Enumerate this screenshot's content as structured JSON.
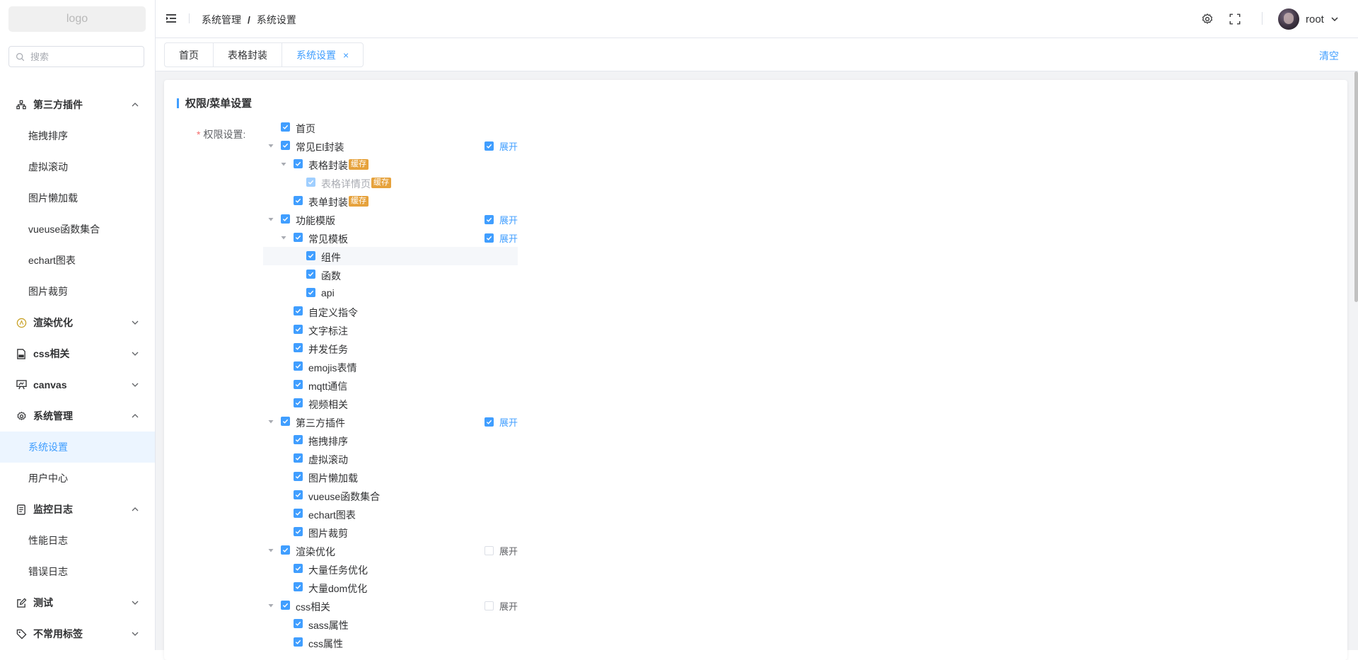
{
  "sidebar": {
    "logo": "logo",
    "search_placeholder": "搜索",
    "menu": [
      {
        "label": "第三方插件",
        "type": "group",
        "expanded": true,
        "icon": "plugin-icon"
      },
      {
        "label": "拖拽排序",
        "type": "sub"
      },
      {
        "label": "虚拟滚动",
        "type": "sub"
      },
      {
        "label": "图片懒加载",
        "type": "sub"
      },
      {
        "label": "vueuse函数集合",
        "type": "sub"
      },
      {
        "label": "echart图表",
        "type": "sub"
      },
      {
        "label": "图片裁剪",
        "type": "sub"
      },
      {
        "label": "渲染优化",
        "type": "group",
        "expanded": false,
        "icon": "render-icon"
      },
      {
        "label": "css相关",
        "type": "group",
        "expanded": false,
        "icon": "css-icon"
      },
      {
        "label": "canvas",
        "type": "group",
        "expanded": false,
        "icon": "canvas-icon"
      },
      {
        "label": "系统管理",
        "type": "group",
        "expanded": true,
        "icon": "gear-icon"
      },
      {
        "label": "系统设置",
        "type": "sub",
        "active": true
      },
      {
        "label": "用户中心",
        "type": "sub"
      },
      {
        "label": "监控日志",
        "type": "group",
        "expanded": true,
        "icon": "document-icon"
      },
      {
        "label": "性能日志",
        "type": "sub"
      },
      {
        "label": "错误日志",
        "type": "sub"
      },
      {
        "label": "测试",
        "type": "group",
        "expanded": false,
        "icon": "edit-icon"
      },
      {
        "label": "不常用标签",
        "type": "group",
        "expanded": false,
        "icon": "tag-icon"
      }
    ]
  },
  "header": {
    "breadcrumb": [
      "系统管理",
      "系统设置"
    ],
    "breadcrumb_sep": "/",
    "username": "root"
  },
  "tabs": {
    "items": [
      {
        "label": "首页",
        "active": false
      },
      {
        "label": "表格封装",
        "active": false
      },
      {
        "label": "系统设置",
        "active": true,
        "closable": true
      }
    ],
    "close_glyph": "×",
    "clear_label": "清空"
  },
  "card": {
    "title": "权限/菜单设置",
    "required_mark": "*",
    "field_label": "权限设置:"
  },
  "tree": [
    {
      "label": "首页",
      "level": 0,
      "checked": true
    },
    {
      "label": "常见El封装",
      "level": 0,
      "checked": true,
      "caret": true,
      "expand": {
        "label": "展开",
        "checked": true
      }
    },
    {
      "label": "表格封装",
      "level": 1,
      "checked": true,
      "caret": true,
      "tag": "缓存"
    },
    {
      "label": "表格详情页",
      "level": 2,
      "checked": true,
      "dim": true,
      "tag": "缓存"
    },
    {
      "label": "表单封装",
      "level": 1,
      "checked": true,
      "tag": "缓存"
    },
    {
      "label": "功能模版",
      "level": 0,
      "checked": true,
      "caret": true,
      "expand": {
        "label": "展开",
        "checked": true
      }
    },
    {
      "label": "常见模板",
      "level": 1,
      "checked": true,
      "caret": true,
      "expand": {
        "label": "展开",
        "checked": true
      }
    },
    {
      "label": "组件",
      "level": 2,
      "checked": true,
      "highlight": true
    },
    {
      "label": "函数",
      "level": 2,
      "checked": true
    },
    {
      "label": "api",
      "level": 2,
      "checked": true
    },
    {
      "label": "自定义指令",
      "level": 1,
      "checked": true
    },
    {
      "label": "文字标注",
      "level": 1,
      "checked": true
    },
    {
      "label": "并发任务",
      "level": 1,
      "checked": true
    },
    {
      "label": "emojis表情",
      "level": 1,
      "checked": true
    },
    {
      "label": "mqtt通信",
      "level": 1,
      "checked": true
    },
    {
      "label": "视频相关",
      "level": 1,
      "checked": true
    },
    {
      "label": "第三方插件",
      "level": 0,
      "checked": true,
      "caret": true,
      "expand": {
        "label": "展开",
        "checked": true
      }
    },
    {
      "label": "拖拽排序",
      "level": 1,
      "checked": true
    },
    {
      "label": "虚拟滚动",
      "level": 1,
      "checked": true
    },
    {
      "label": "图片懒加载",
      "level": 1,
      "checked": true
    },
    {
      "label": "vueuse函数集合",
      "level": 1,
      "checked": true
    },
    {
      "label": "echart图表",
      "level": 1,
      "checked": true
    },
    {
      "label": "图片裁剪",
      "level": 1,
      "checked": true
    },
    {
      "label": "渲染优化",
      "level": 0,
      "checked": true,
      "caret": true,
      "expand": {
        "label": "展开",
        "checked": false
      }
    },
    {
      "label": "大量任务优化",
      "level": 1,
      "checked": true
    },
    {
      "label": "大量dom优化",
      "level": 1,
      "checked": true
    },
    {
      "label": "css相关",
      "level": 0,
      "checked": true,
      "caret": true,
      "expand": {
        "label": "展开",
        "checked": false
      }
    },
    {
      "label": "sass属性",
      "level": 1,
      "checked": true
    },
    {
      "label": "css属性",
      "level": 1,
      "checked": true
    }
  ],
  "colors": {
    "accent": "#409eff",
    "tag": "#e6a23c",
    "active_bg": "#ecf5ff"
  }
}
